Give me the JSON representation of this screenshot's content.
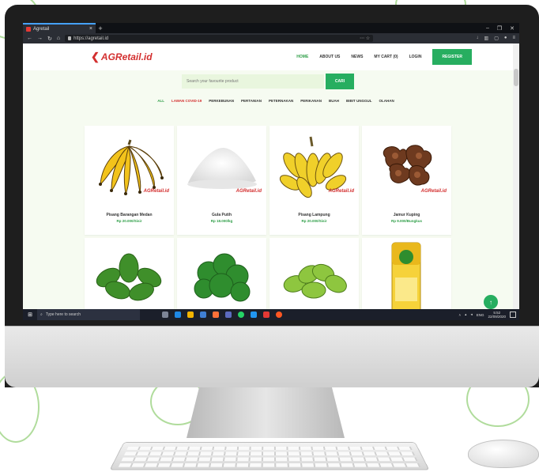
{
  "browser": {
    "tab_title": "Agretail",
    "url": "https://agretail.id"
  },
  "site": {
    "logo_text": "AGRetail.id",
    "menu": [
      "HOME",
      "ABOUT US",
      "NEWS",
      "MY CART (0)",
      "LOGIN"
    ],
    "register_label": "REGISTER",
    "search_placeholder": "Search your favourite product",
    "search_button": "CARI",
    "categories": [
      "ALL",
      "LAWAN COVID-19",
      "PERKEBUNAN",
      "PERTANIAN",
      "PETERNAKAN",
      "PERIKANAN",
      "BUAH",
      "BIBIT UNGGUL",
      "OLAHAN"
    ],
    "watermark": "AGRetail.id",
    "products": [
      {
        "name": "Pisang Barangan Medan",
        "price": "Rp 20.000/Sisir",
        "icon": "banana-barangan"
      },
      {
        "name": "Gula Putih",
        "price": "Rp 18.000/kg",
        "icon": "white-sugar"
      },
      {
        "name": "Pisang Lampung",
        "price": "Rp 20.000/Sisir",
        "icon": "banana-lampung"
      },
      {
        "name": "Jamur Kuping",
        "price": "Rp 9.000/Bungkus",
        "icon": "wood-ear-mushroom"
      },
      {
        "name": "",
        "price": "",
        "icon": "spinach"
      },
      {
        "name": "",
        "price": "",
        "icon": "green-vegetable"
      },
      {
        "name": "",
        "price": "",
        "icon": "chayote"
      },
      {
        "name": "",
        "price": "",
        "icon": "cooking-oil"
      }
    ]
  },
  "taskbar": {
    "search_placeholder": "Type here to search",
    "language": "ENG",
    "time": "5:52",
    "date": "22/09/2020"
  },
  "colors": {
    "brand_green": "#27ae60",
    "brand_red": "#d32f2f",
    "page_bg": "#f6fbf1"
  }
}
